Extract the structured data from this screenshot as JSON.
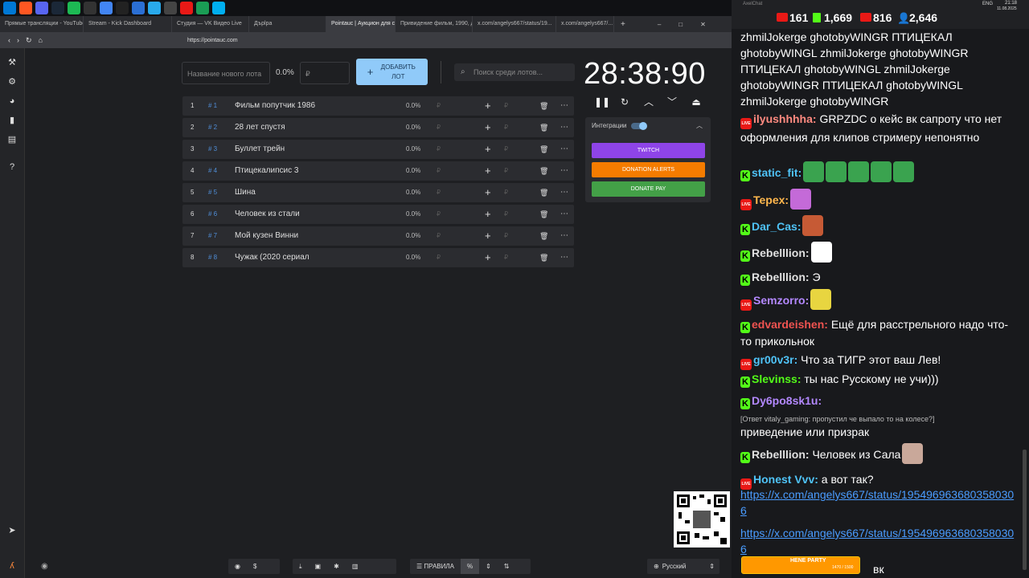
{
  "taskbar": {
    "icons": [
      "windows-icon",
      "brave-icon",
      "discord-icon",
      "steam-icon",
      "spotify-icon",
      "obs-icon",
      "chrome-icon",
      "x-icon",
      "browser-icon",
      "telegram-icon",
      "media-icon",
      "video-icon",
      "network-icon",
      "skype-icon"
    ],
    "tray": {
      "lang": "ENG",
      "time": "21:18",
      "date": "11.08.2025"
    }
  },
  "browser": {
    "tabs": [
      {
        "label": "Прямые трансляции - YouTube",
        "active": false
      },
      {
        "label": "Stream - Kick Dashboard",
        "active": false
      },
      {
        "label": "Студия — VK Видео Live",
        "active": false
      },
      {
        "label": "Дърlра",
        "active": false
      },
      {
        "label": "Pointauc | Аукцион для с...",
        "active": true
      },
      {
        "label": "Привидение фильм, 1990, д...",
        "active": false
      },
      {
        "label": "x.com/angelys667/status/19...",
        "active": false
      },
      {
        "label": "x.com/angelys667/...",
        "active": false
      }
    ],
    "url": "https://pointauc.com",
    "window_controls": [
      "–",
      "□",
      "✕"
    ]
  },
  "app": {
    "new_lot_placeholder": "Название нового лота",
    "new_lot_pct": "0.0%",
    "price_placeholder": "₽",
    "add_button": "ДОБАВИТЬ ЛОТ",
    "search_placeholder": "Поиск среди лотов...",
    "timer": "28:38:90",
    "integrations_label": "Интеграции",
    "integrations": [
      {
        "label": "TWITCH",
        "color": "#8e44e8"
      },
      {
        "label": "DONATION ALERTS",
        "color": "#f57c00"
      },
      {
        "label": "DONATE PAY",
        "color": "#43a047"
      }
    ],
    "lots": [
      {
        "num": "1",
        "id": "# 1",
        "name": "Фильм попутчик 1986",
        "pct": "0.0%"
      },
      {
        "num": "2",
        "id": "# 2",
        "name": "28 лет спустя",
        "pct": "0.0%"
      },
      {
        "num": "3",
        "id": "# 3",
        "name": "Буллет трейн",
        "pct": "0.0%"
      },
      {
        "num": "4",
        "id": "# 4",
        "name": "Птицекалипсис 3",
        "pct": "0.0%"
      },
      {
        "num": "5",
        "id": "# 5",
        "name": " Шина",
        "pct": "0.0%"
      },
      {
        "num": "6",
        "id": "# 6",
        "name": "Человек из стали",
        "pct": "0.0%"
      },
      {
        "num": "7",
        "id": "# 7",
        "name": "Мой кузен Винни",
        "pct": "0.0%"
      },
      {
        "num": "8",
        "id": "# 8",
        "name": "Чужак (2020 сериал",
        "pct": "0.0%"
      }
    ],
    "currency": "₽",
    "bottom": {
      "rules": "ПРАВИЛА",
      "percent": "%",
      "language": "Русский"
    }
  },
  "chat": {
    "title": "AxelChat",
    "stats": {
      "viewers_a": "161",
      "viewers_kick": "1,669",
      "viewers_live": "816",
      "viewers_total": "2,646"
    },
    "spam": "zhmilJokerge ghotobyWINGR ПТИЦЕКАЛ ghotobyWINGL zhmilJokerge ghotobyWINGR ПТИЦЕКАЛ ghotobyWINGL zhmilJokerge ghotobyWINGR ПТИЦЕКАЛ ghotobyWINGL zhmilJokerge ghotobyWINGR",
    "messages": [
      {
        "platform": "live",
        "nick": "ilyushhhha:",
        "nick_color": "#ff8a80",
        "text": "GRPZDC о кейс вк сапроту что нет оформления для клипов стримеру непонятно"
      },
      {
        "platform": "kick",
        "nick": "static_fit:",
        "nick_color": "#4fc3f7",
        "text": ""
      },
      {
        "platform": "live",
        "nick": "Tepex:",
        "nick_color": "#ffb74d",
        "text": ""
      },
      {
        "platform": "kick",
        "nick": "Dar_Cas:",
        "nick_color": "#4fc3f7",
        "text": ""
      },
      {
        "platform": "kick",
        "nick": "Rebelllion:",
        "nick_color": "#e0e0e0",
        "text": ""
      },
      {
        "platform": "kick",
        "nick": "Rebelllion:",
        "nick_color": "#e0e0e0",
        "text": "Э"
      },
      {
        "platform": "live",
        "nick": "Semzorro:",
        "nick_color": "#b388ff",
        "text": ""
      },
      {
        "platform": "kick",
        "nick": "edvardeishen:",
        "nick_color": "#ef5350",
        "text": "Ещё для расстрельного надо что-то прикольнок"
      },
      {
        "platform": "live",
        "nick": "gr00v3r:",
        "nick_color": "#4fc3f7",
        "text": "Что за ТИГР этот ваш Лев!"
      },
      {
        "platform": "kick",
        "nick": "Slevinss:",
        "nick_color": "#53fc18",
        "text": "ты нас Русскому не учи)))"
      },
      {
        "platform": "kick",
        "nick": "Dy6po8sk1u:",
        "nick_color": "#b388ff",
        "text": ""
      },
      {
        "reply": "[Ответ vitaly_gaming: пропустил че выпало то на колесе?]"
      },
      {
        "text_only": "приведение или призрак"
      },
      {
        "platform": "kick",
        "nick": "Rebelllion:",
        "nick_color": "#e0e0e0",
        "text": "Человек из Сала"
      },
      {
        "platform": "live",
        "nick": "Honest Vvv:",
        "nick_color": "#4fc3f7",
        "text": "а вот так?"
      },
      {
        "link": "https://x.com/angelys667/status/1954969636803580306"
      },
      {
        "link": "https://x.com/angelys667/status/1954969636803580306"
      },
      {
        "text_only": "вк"
      }
    ],
    "banner": "HENE PARTY",
    "banner_progress": "1470 / 1500"
  }
}
